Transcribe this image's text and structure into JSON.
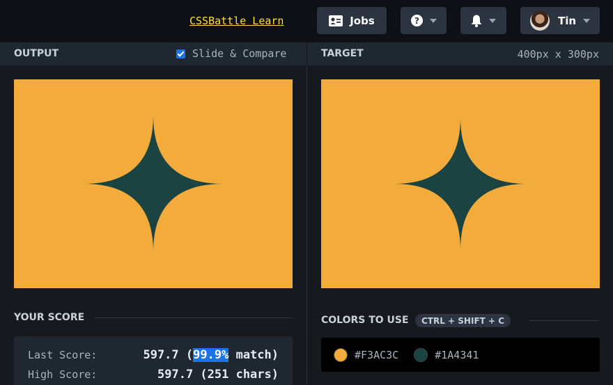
{
  "nav": {
    "learn_link": "CSSBattle Learn",
    "jobs_label": "Jobs",
    "user_name": "Tin"
  },
  "output_panel": {
    "title": "OUTPUT",
    "slide_compare_label": "Slide & Compare",
    "slide_compare_checked": true
  },
  "target_panel": {
    "title": "TARGET",
    "dimensions": "400px x 300px"
  },
  "score": {
    "title": "YOUR SCORE",
    "last_label": "Last Score:",
    "last_score": "597.7",
    "match_percent": "99.9%",
    "match_suffix": "match)",
    "high_label": "High Score:",
    "high_value": "597.7 (251 chars)"
  },
  "colors": {
    "title": "COLORS TO USE",
    "shortcut": "CTRL + SHIFT + C",
    "palette": [
      {
        "hex": "#F3AC3C"
      },
      {
        "hex": "#1A4341"
      }
    ]
  },
  "icons": {
    "jobs": "id-card-icon",
    "help": "question-circle-icon",
    "bell": "bell-icon",
    "caret": "chevron-down-icon"
  }
}
